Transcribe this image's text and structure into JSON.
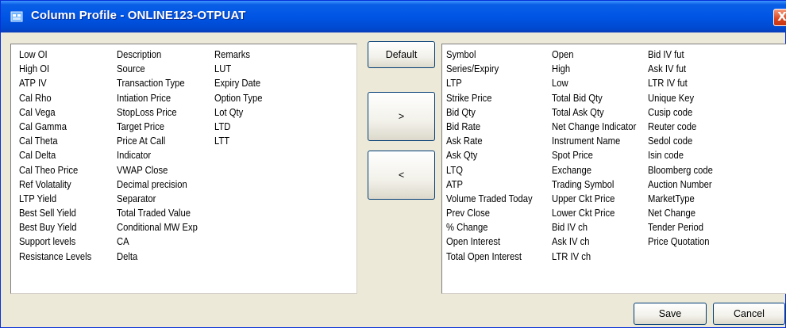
{
  "window": {
    "title": "Column Profile - ONLINE123-OTPUAT",
    "close_label": "X"
  },
  "available_columns": [
    [
      "Low OI",
      "High OI",
      "ATP IV",
      "Cal Rho",
      "Cal Vega",
      "Cal Gamma",
      "Cal Theta",
      "Cal Delta",
      "Cal Theo Price",
      "Ref Volatality",
      "LTP Yield",
      "Best Sell Yield",
      "Best Buy Yield",
      "Support levels",
      "Resistance Levels"
    ],
    [
      "Description",
      "Source",
      "Transaction Type",
      "Intiation Price",
      "StopLoss Price",
      "Target Price",
      "Price At Call",
      "Indicator",
      "VWAP Close",
      "Decimal precision",
      "Separator",
      "Total Traded Value",
      "Conditional MW Exp",
      "CA",
      "Delta"
    ],
    [
      "Remarks",
      "LUT",
      "Expiry Date",
      "Option Type",
      "Lot Qty",
      "LTD",
      "LTT"
    ]
  ],
  "selected_columns": [
    [
      "Symbol",
      "Series/Expiry",
      "LTP",
      "Strike Price",
      "Bid Qty",
      "Bid Rate",
      "Ask Rate",
      "Ask Qty",
      "LTQ",
      "ATP",
      "Volume Traded Today",
      "Prev Close",
      "% Change",
      "Open Interest",
      "Total Open Interest"
    ],
    [
      "Open",
      "High",
      "Low",
      "Total Bid Qty",
      "Total Ask Qty",
      "Net Change Indicator",
      "Instrument Name",
      "Spot Price",
      "Exchange",
      "Trading Symbol",
      "Upper Ckt Price",
      "Lower Ckt Price",
      "Bid IV ch",
      "Ask IV ch",
      "LTR IV ch"
    ],
    [
      "Bid IV fut",
      "Ask IV fut",
      "LTR IV fut",
      "Unique Key",
      "Cusip code",
      "Reuter code",
      "Sedol code",
      "Isin code",
      "Bloomberg code",
      "Auction Number",
      "MarketType",
      "Net Change",
      "Tender Period",
      "Price  Quotation"
    ]
  ],
  "buttons": {
    "default": "Default",
    "move_right": ">",
    "move_left": "<",
    "save": "Save",
    "cancel": "Cancel"
  }
}
